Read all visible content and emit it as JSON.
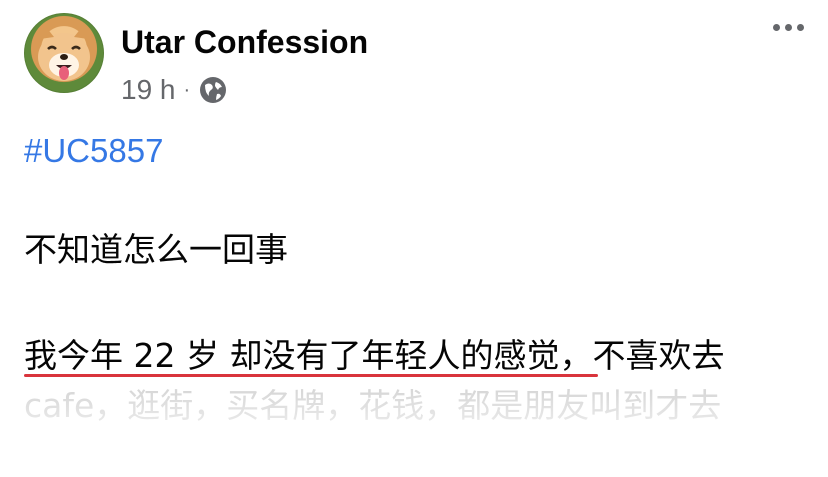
{
  "post": {
    "author": "Utar Confession",
    "time": "19 h",
    "separator": "·",
    "privacy_icon": "globe-icon",
    "menu_icon": "more-options-icon",
    "hashtag": "#UC5857",
    "lines": [
      "不知道怎么一回事",
      "我今年 22 岁 却没有了年轻人的感觉，不喜欢去",
      "cafe，逛街，买名牌，花钱，都是朋友叫到才去"
    ]
  },
  "colors": {
    "hashtag": "#3578e5",
    "underline": "#d9343c",
    "meta": "#65676b"
  }
}
